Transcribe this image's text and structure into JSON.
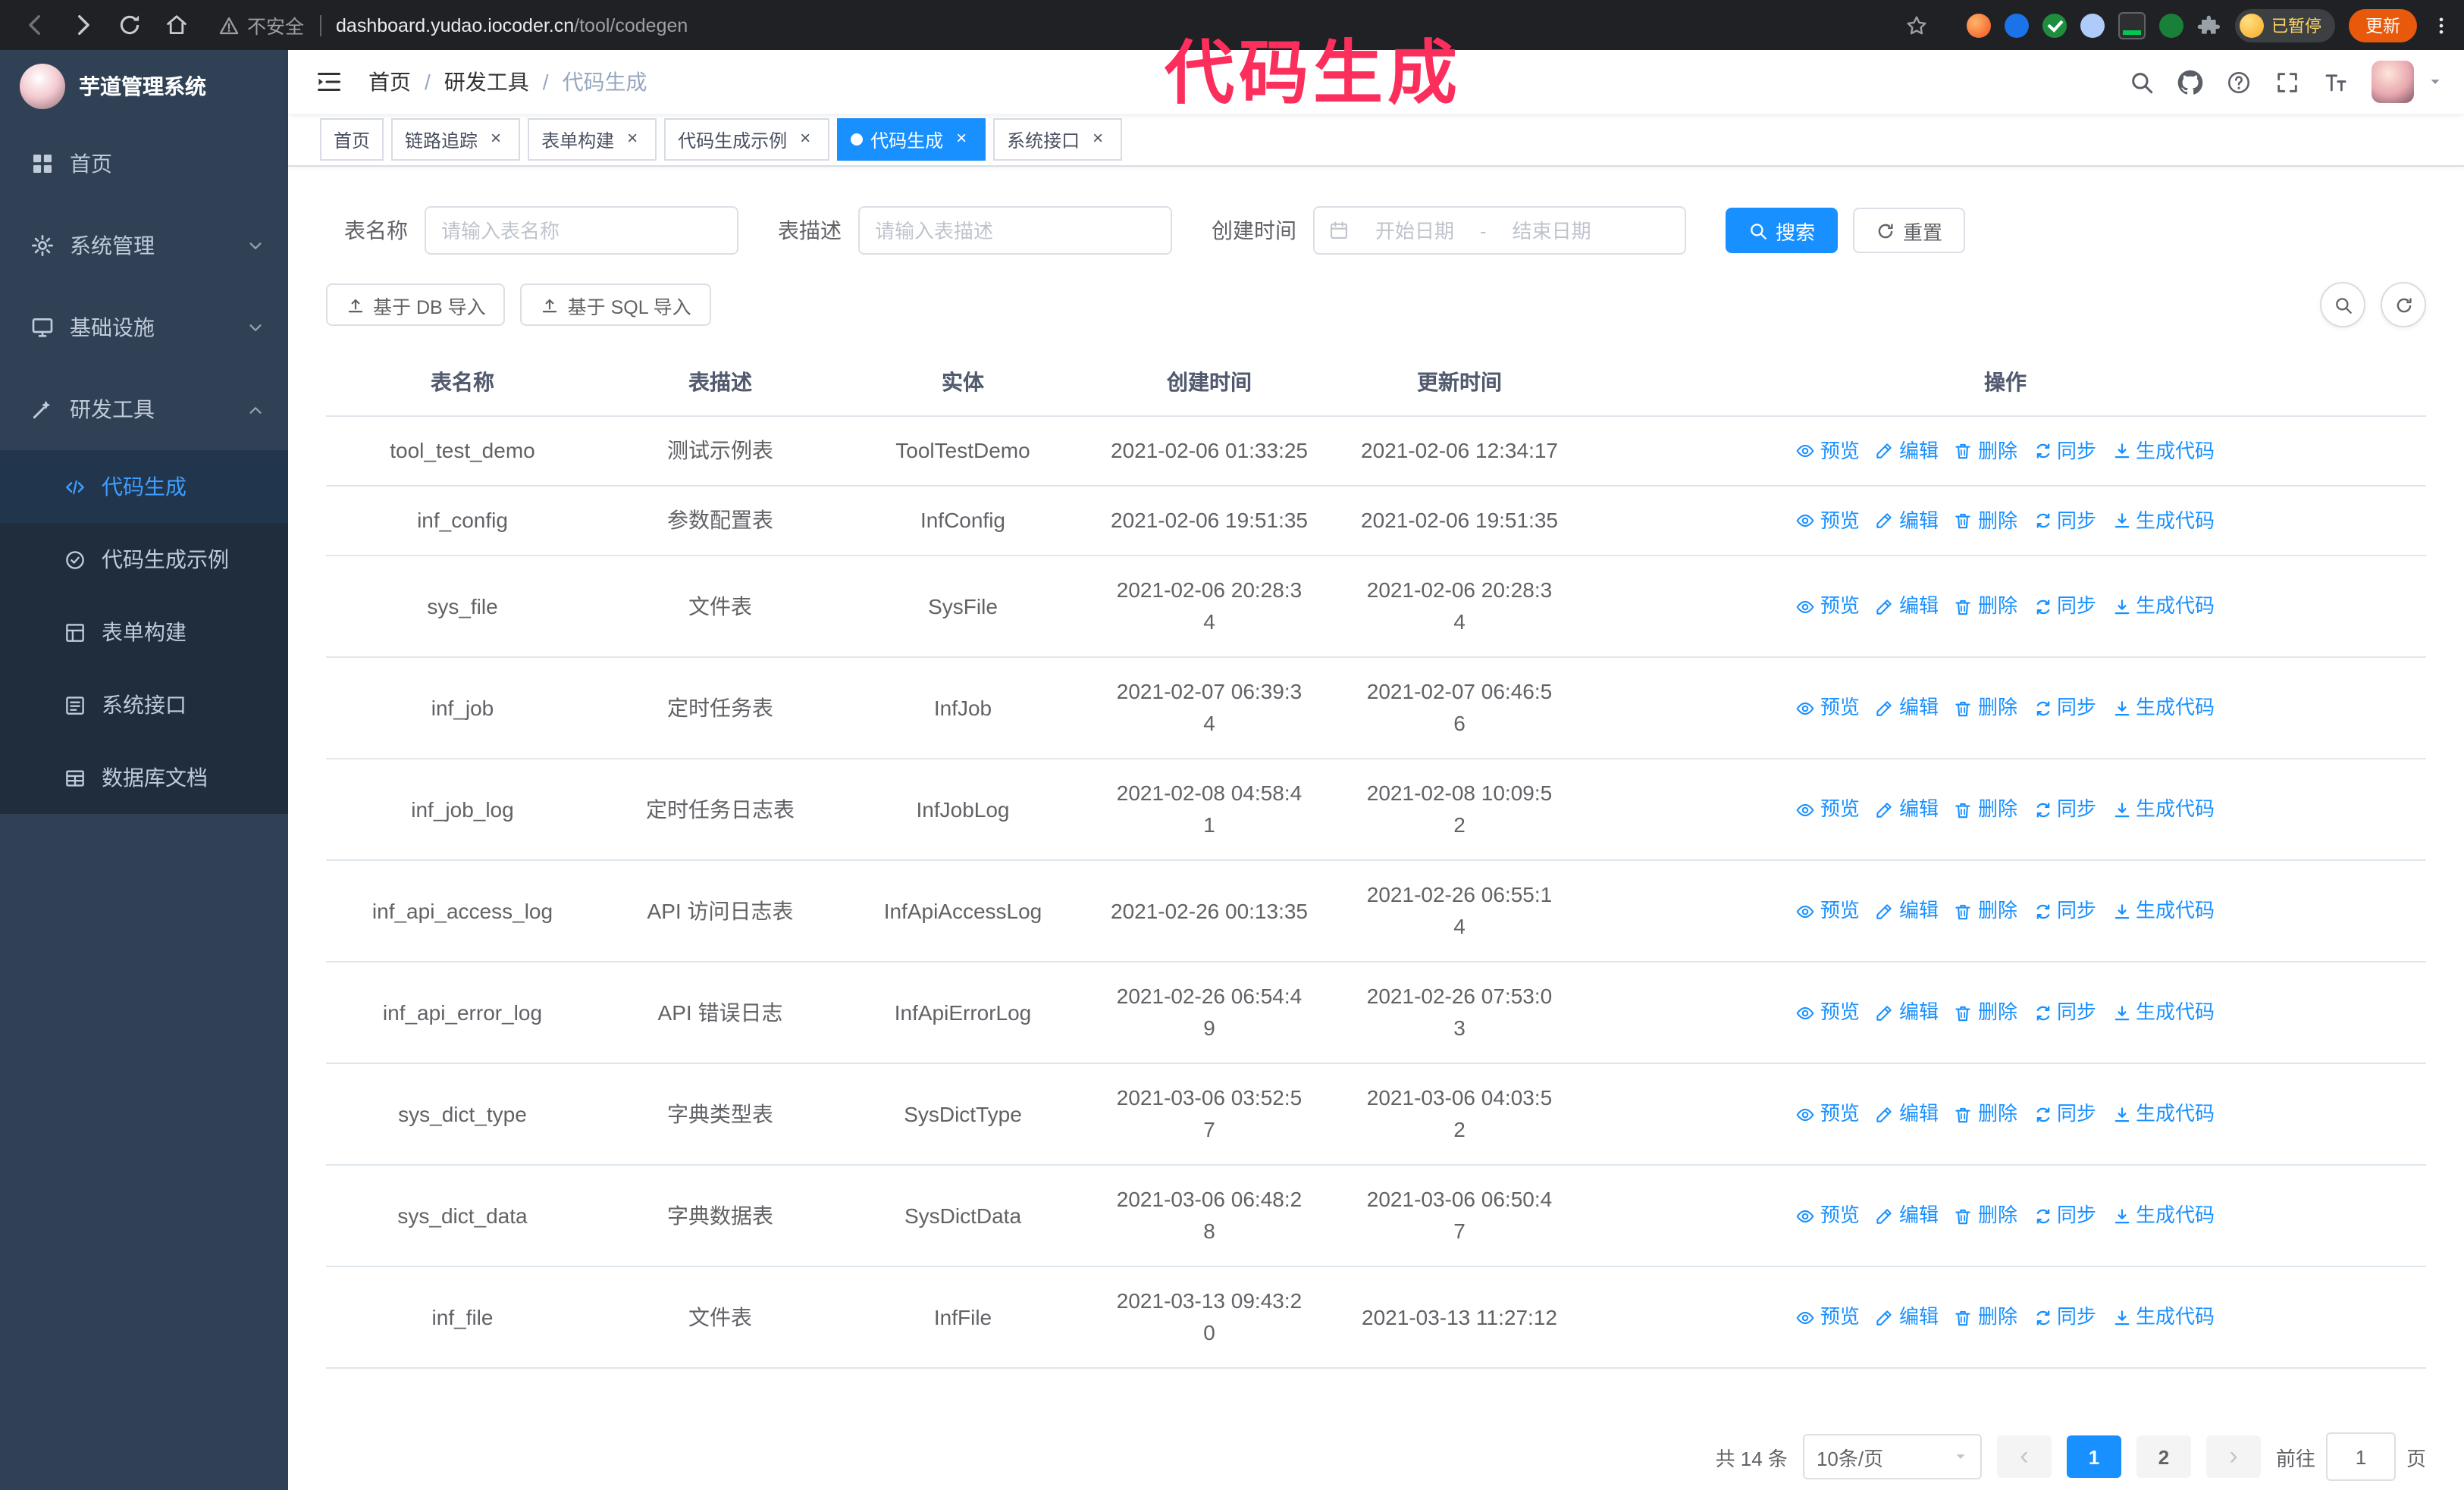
{
  "colors": {
    "accent": "#1890ff",
    "annotation": "#fb2e5c",
    "sidebar_bg": "#304156",
    "submenu_bg": "#1f2d3d",
    "active_menu_text": "#409eff"
  },
  "browser": {
    "security_label": "不安全",
    "url_host": "dashboard.yudao.iocoder.cn",
    "url_path": "/tool/codegen",
    "profile_badge": "已暂停",
    "update_button": "更新"
  },
  "annotation": {
    "text": "代码生成",
    "color": "#fb2e5c"
  },
  "sidebar": {
    "logo_title": "芋道管理系统",
    "items": [
      {
        "label": "首页",
        "expandable": false
      },
      {
        "label": "系统管理",
        "expandable": true
      },
      {
        "label": "基础设施",
        "expandable": true
      },
      {
        "label": "研发工具",
        "expandable": true,
        "expanded": true
      }
    ],
    "sub_items": [
      {
        "label": "代码生成",
        "active": true
      },
      {
        "label": "代码生成示例"
      },
      {
        "label": "表单构建"
      },
      {
        "label": "系统接口"
      },
      {
        "label": "数据库文档"
      }
    ]
  },
  "header": {
    "breadcrumb": [
      "首页",
      "研发工具",
      "代码生成"
    ]
  },
  "tabs": [
    {
      "label": "首页",
      "closable": false,
      "active": false
    },
    {
      "label": "链路追踪",
      "closable": true,
      "active": false
    },
    {
      "label": "表单构建",
      "closable": true,
      "active": false
    },
    {
      "label": "代码生成示例",
      "closable": true,
      "active": false
    },
    {
      "label": "代码生成",
      "closable": true,
      "active": true
    },
    {
      "label": "系统接口",
      "closable": true,
      "active": false
    }
  ],
  "filters": {
    "table_name_label": "表名称",
    "table_name_placeholder": "请输入表名称",
    "table_desc_label": "表描述",
    "table_desc_placeholder": "请输入表描述",
    "create_time_label": "创建时间",
    "date_start_placeholder": "开始日期",
    "date_separator": "-",
    "date_end_placeholder": "结束日期",
    "search_button": "搜索",
    "reset_button": "重置"
  },
  "toolbar": {
    "import_db_button": "基于 DB 导入",
    "import_sql_button": "基于 SQL 导入"
  },
  "table": {
    "columns": [
      "表名称",
      "表描述",
      "实体",
      "创建时间",
      "更新时间",
      "操作"
    ],
    "actions": [
      "预览",
      "编辑",
      "删除",
      "同步",
      "生成代码"
    ],
    "rows": [
      {
        "name": "tool_test_demo",
        "desc": "测试示例表",
        "entity": "ToolTestDemo",
        "created": "2021-02-06 01:33:25",
        "updated": "2021-02-06 12:34:17"
      },
      {
        "name": "inf_config",
        "desc": "参数配置表",
        "entity": "InfConfig",
        "created": "2021-02-06 19:51:35",
        "updated": "2021-02-06 19:51:35"
      },
      {
        "name": "sys_file",
        "desc": "文件表",
        "entity": "SysFile",
        "created": "2021-02-06 20:28:3\n4",
        "updated": "2021-02-06 20:28:3\n4"
      },
      {
        "name": "inf_job",
        "desc": "定时任务表",
        "entity": "InfJob",
        "created": "2021-02-07 06:39:3\n4",
        "updated": "2021-02-07 06:46:5\n6"
      },
      {
        "name": "inf_job_log",
        "desc": "定时任务日志表",
        "entity": "InfJobLog",
        "created": "2021-02-08 04:58:4\n1",
        "updated": "2021-02-08 10:09:5\n2"
      },
      {
        "name": "inf_api_access_log",
        "desc": "API 访问日志表",
        "entity": "InfApiAccessLog",
        "created": "2021-02-26 00:13:35",
        "updated": "2021-02-26 06:55:1\n4"
      },
      {
        "name": "inf_api_error_log",
        "desc": "API 错误日志",
        "entity": "InfApiErrorLog",
        "created": "2021-02-26 06:54:4\n9",
        "updated": "2021-02-26 07:53:0\n3"
      },
      {
        "name": "sys_dict_type",
        "desc": "字典类型表",
        "entity": "SysDictType",
        "created": "2021-03-06 03:52:5\n7",
        "updated": "2021-03-06 04:03:5\n2"
      },
      {
        "name": "sys_dict_data",
        "desc": "字典数据表",
        "entity": "SysDictData",
        "created": "2021-03-06 06:48:2\n8",
        "updated": "2021-03-06 06:50:4\n7"
      },
      {
        "name": "inf_file",
        "desc": "文件表",
        "entity": "InfFile",
        "created": "2021-03-13 09:43:2\n0",
        "updated": "2021-03-13 11:27:12"
      }
    ]
  },
  "pagination": {
    "total": "共 14 条",
    "page_size": "10条/页",
    "pages": [
      "1",
      "2"
    ],
    "goto_label": "前往",
    "goto_value": "1",
    "goto_suffix": "页"
  }
}
